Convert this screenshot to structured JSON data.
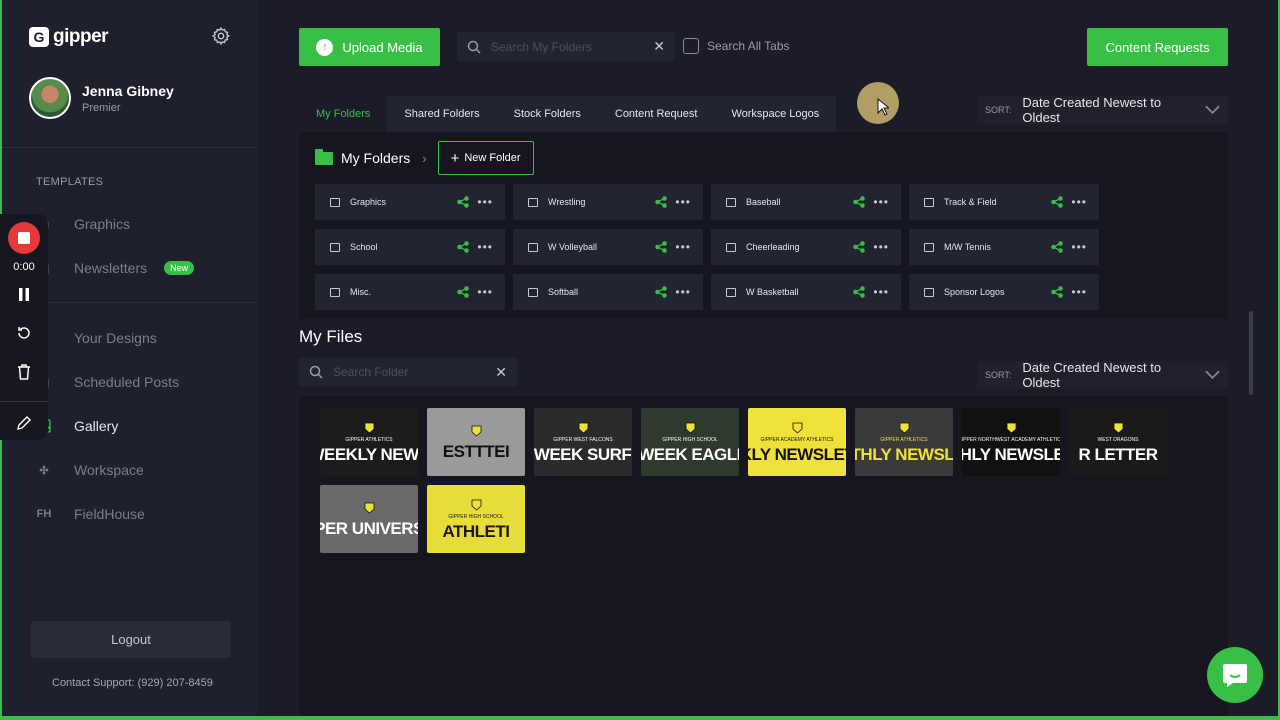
{
  "app": {
    "logo": "gipper"
  },
  "user": {
    "name": "Jenna Gibney",
    "tier": "Premier"
  },
  "sidebar": {
    "section_label": "TEMPLATES",
    "items": [
      {
        "label": "Graphics",
        "icon": "graphics-icon"
      },
      {
        "label": "Newsletters",
        "icon": "newsletter-icon",
        "badge": "New"
      },
      {
        "label": "Your Designs",
        "icon": "designs-icon"
      },
      {
        "label": "Scheduled Posts",
        "icon": "calendar-icon"
      },
      {
        "label": "Gallery",
        "icon": "gallery-icon",
        "active": true
      },
      {
        "label": "Workspace",
        "icon": "workspace-icon"
      },
      {
        "label": "FieldHouse",
        "icon": "fieldhouse-icon",
        "icon_text": "FH"
      }
    ],
    "logout_label": "Logout",
    "support_text": "Contact Support:  (929) 207-8459"
  },
  "recorder": {
    "time": "0:00"
  },
  "toolbar": {
    "upload_label": "Upload Media",
    "search_placeholder": "Search My Folders",
    "search_all_label": "Search All Tabs",
    "content_requests_label": "Content Requests"
  },
  "tabs": [
    {
      "label": "My Folders",
      "active": true
    },
    {
      "label": "Shared Folders"
    },
    {
      "label": "Stock Folders"
    },
    {
      "label": "Content Request"
    },
    {
      "label": "Workspace Logos"
    }
  ],
  "sort": {
    "label": "SORT:",
    "value": "Date Created Newest to Oldest"
  },
  "folders": {
    "title": "My Folders",
    "new_folder_label": "New Folder",
    "items": [
      "Graphics",
      "Wrestling",
      "Baseball",
      "Track & Field",
      "School",
      "W Volleyball",
      "Cheerleading",
      "M/W Tennis",
      "Misc.",
      "Softball",
      "W Basketball",
      "Sponsor Logos"
    ]
  },
  "files": {
    "title": "My Files",
    "search_placeholder": "Search Folder",
    "sort_label": "SORT:",
    "sort_value": "Date Created Newest to Oldest",
    "thumbnails": [
      {
        "sub": "GIPPER ATHLETICS",
        "text": "WEEKLY NEWS",
        "bg": "#1c1c1c",
        "fg": "#ffffff"
      },
      {
        "sub": "",
        "text": "ESTTTEI",
        "bg": "#9a9a9a",
        "fg": "#111111"
      },
      {
        "sub": "GIPPER WEST FALCONS",
        "text": "THE WEEK SURF REP",
        "bg": "#2b2b2b",
        "fg": "#ffffff"
      },
      {
        "sub": "GIPPER HIGH SCHOOL",
        "text": "THE WEEK EAGLE REI",
        "bg": "#2f3a2f",
        "fg": "#ffffff"
      },
      {
        "sub": "GIPPER ACADEMY ATHLETICS",
        "text": "KLY NEWSLET",
        "bg": "#f0e13a",
        "fg": "#111111"
      },
      {
        "sub": "GIPPER ATHLETICS",
        "text": "MONTHLY NEWSLETTE",
        "bg": "#3a3a3a",
        "fg": "#f0e13a"
      },
      {
        "sub": "GIPPER NORTHWEST ACADEMY ATHLETICS",
        "text": "NTHLY NEWSLETT",
        "bg": "#111111",
        "fg": "#ffffff"
      },
      {
        "sub": "WEST DRAGONS",
        "text": "R LETTER",
        "bg": "#1a1a1a",
        "fg": "#ffffff"
      },
      {
        "sub": "",
        "text": "PER UNIVERS",
        "bg": "#6a6a6a",
        "fg": "#ffffff"
      },
      {
        "sub": "GIPPER HIGH SCHOOL",
        "text": "ATHLETI",
        "bg": "#e8dc3a",
        "fg": "#1a1a1a"
      }
    ]
  },
  "colors": {
    "accent": "#38c046",
    "background": "#1b1c28",
    "sidebar": "#1f202d",
    "panel": "#151620"
  }
}
